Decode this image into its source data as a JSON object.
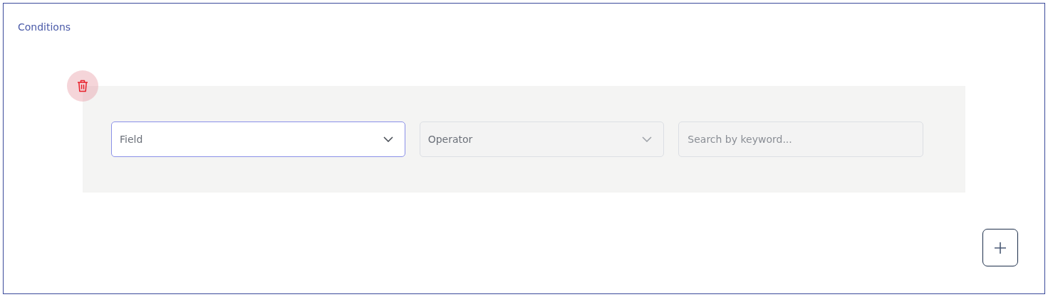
{
  "section": {
    "title": "Conditions"
  },
  "condition": {
    "field_select": {
      "placeholder": "Field",
      "focused": true,
      "disabled": false
    },
    "operator_select": {
      "placeholder": "Operator",
      "focused": false,
      "disabled": true
    },
    "keyword_search": {
      "placeholder": "Search by keyword..."
    }
  }
}
